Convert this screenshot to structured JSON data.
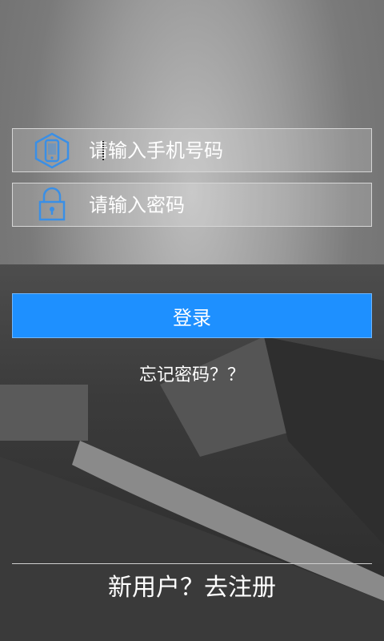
{
  "login": {
    "phone_placeholder": "请输入手机号码",
    "password_placeholder": "请输入密码",
    "login_button": "登录",
    "forgot_password": "忘记密码？？",
    "register_link": "新用户？去注册"
  },
  "icons": {
    "phone": "phone-hexagon-icon",
    "lock": "lock-icon"
  },
  "colors": {
    "accent": "#1e90ff",
    "icon_blue": "#3a8fe6"
  }
}
